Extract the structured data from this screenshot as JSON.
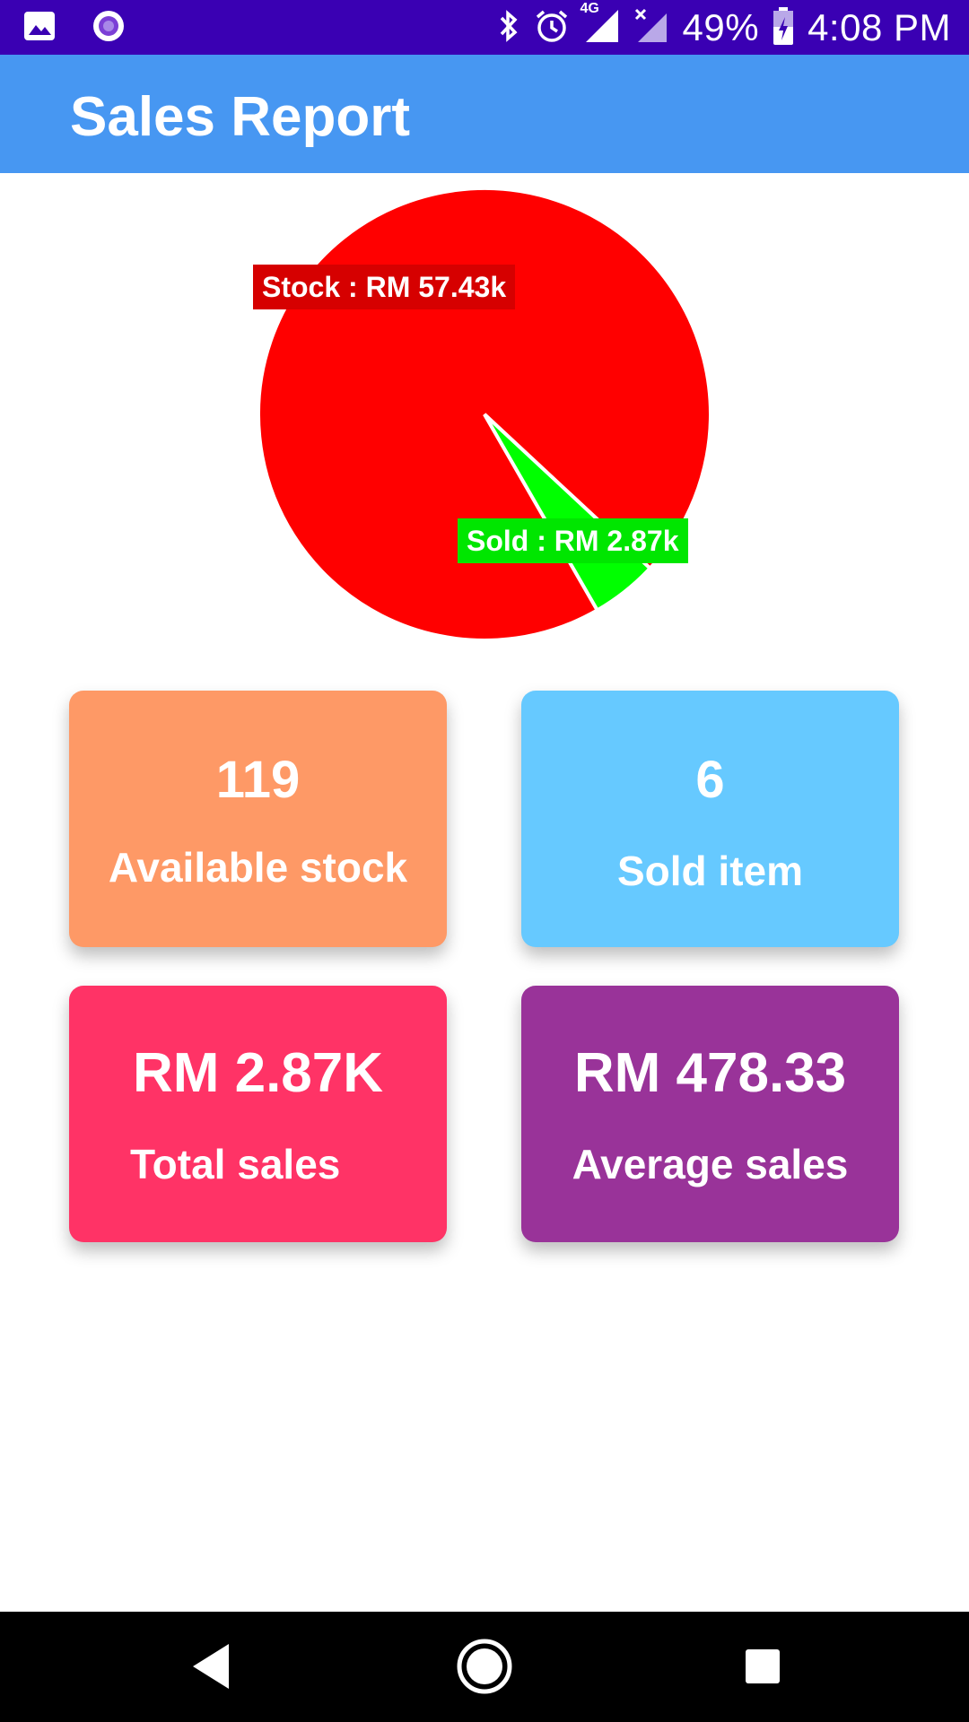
{
  "status_bar": {
    "battery": "49%",
    "time": "4:08 PM",
    "network_label": "4G",
    "icons": [
      "image-icon",
      "radio-app-icon",
      "bluetooth-icon",
      "alarm-icon",
      "signal-icon",
      "signal-no-service-icon",
      "battery-charging-icon"
    ]
  },
  "app_bar": {
    "title": "Sales Report"
  },
  "chart_data": {
    "type": "pie",
    "slices": [
      {
        "label": "Stock : RM 57.43k",
        "value": 57.43,
        "color": "#ff0000"
      },
      {
        "label": "Sold : RM 2.87k",
        "value": 2.87,
        "color": "#00ff00"
      }
    ],
    "label_colors": {
      "stock": "#d60000",
      "sold": "#00e600"
    }
  },
  "cards": {
    "stock": {
      "value": "119",
      "label": "Available stock",
      "color": "#fe9966"
    },
    "sold": {
      "value": "6",
      "label": "Sold item",
      "color": "#66c9ff"
    },
    "total": {
      "value": "RM 2.87K",
      "label": "Total sales",
      "color": "#ff3366"
    },
    "average": {
      "value": "RM 478.33",
      "label": "Average sales",
      "color": "#993399"
    }
  },
  "nav": {
    "icons": [
      "back-icon",
      "home-icon",
      "recent-apps-icon"
    ]
  }
}
